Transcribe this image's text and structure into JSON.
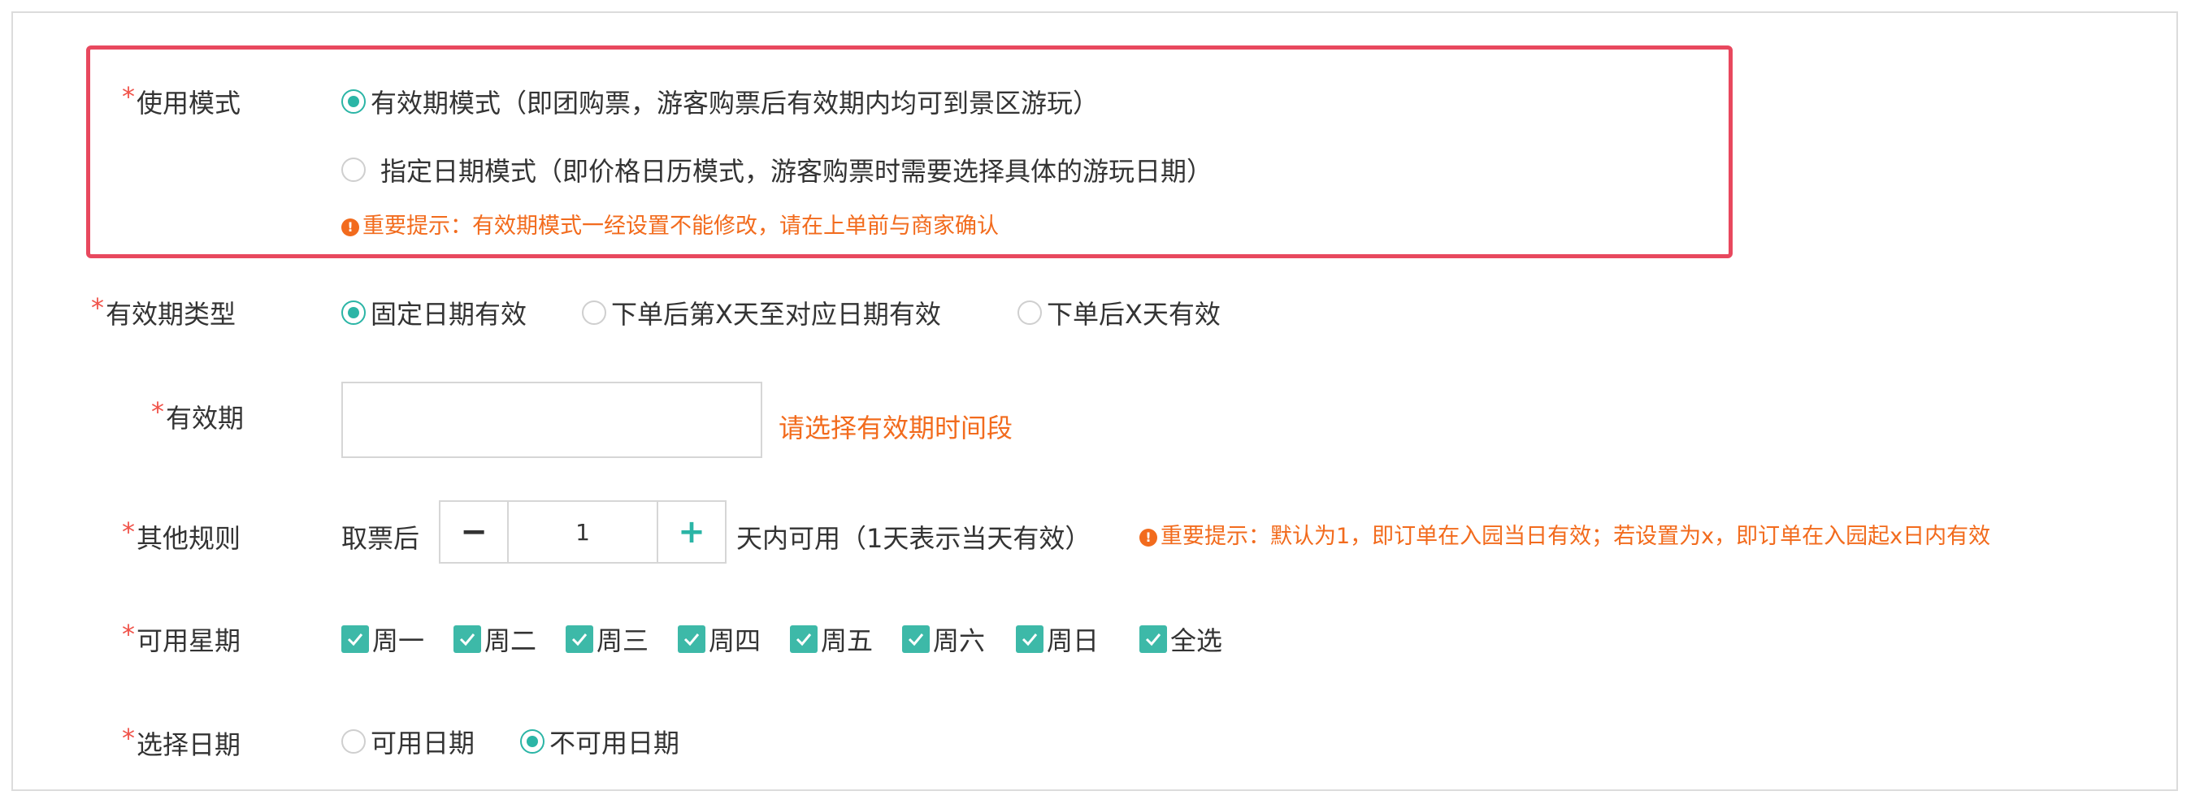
{
  "colors": {
    "accent": "#2bb5a6",
    "required": "#f0534a",
    "warning": "#f26b1d",
    "highlight_border": "#e8485e"
  },
  "usage_mode": {
    "label": "使用模式",
    "required_mark": "*",
    "options": [
      {
        "label": "有效期模式（即团购票，游客购票后有效期内均可到景区游玩）",
        "checked": true
      },
      {
        "label": "指定日期模式（即价格日历模式，游客购票时需要选择具体的游玩日期）",
        "checked": false
      }
    ],
    "warning_icon": "exclamation-circle-icon",
    "warning": "重要提示：有效期模式一经设置不能修改，请在上单前与商家确认"
  },
  "validity_type": {
    "label": "有效期类型",
    "required_mark": "*",
    "options": [
      {
        "label": "固定日期有效",
        "checked": true
      },
      {
        "label": "下单后第X天至对应日期有效",
        "checked": false
      },
      {
        "label": "下单后X天有效",
        "checked": false
      }
    ]
  },
  "validity_period": {
    "label": "有效期",
    "required_mark": "*",
    "value": "",
    "hint": "请选择有效期时间段"
  },
  "other_rules": {
    "label": "其他规则",
    "required_mark": "*",
    "prefix": "取票后",
    "minus_label": "−",
    "plus_label": "+",
    "stepper_value": "1",
    "suffix": "天内可用（1天表示当天有效）",
    "warning_icon": "exclamation-circle-icon",
    "warning": "重要提示：默认为1，即订单在入园当日有效；若设置为x，即订单在入园起x日内有效"
  },
  "available_weekdays": {
    "label": "可用星期",
    "required_mark": "*",
    "options": [
      {
        "label": "周一",
        "checked": true
      },
      {
        "label": "周二",
        "checked": true
      },
      {
        "label": "周三",
        "checked": true
      },
      {
        "label": "周四",
        "checked": true
      },
      {
        "label": "周五",
        "checked": true
      },
      {
        "label": "周六",
        "checked": true
      },
      {
        "label": "周日",
        "checked": true
      },
      {
        "label": "全选",
        "checked": true
      }
    ]
  },
  "select_dates": {
    "label": "选择日期",
    "required_mark": "*",
    "options": [
      {
        "label": "可用日期",
        "checked": false
      },
      {
        "label": "不可用日期",
        "checked": true
      }
    ]
  }
}
